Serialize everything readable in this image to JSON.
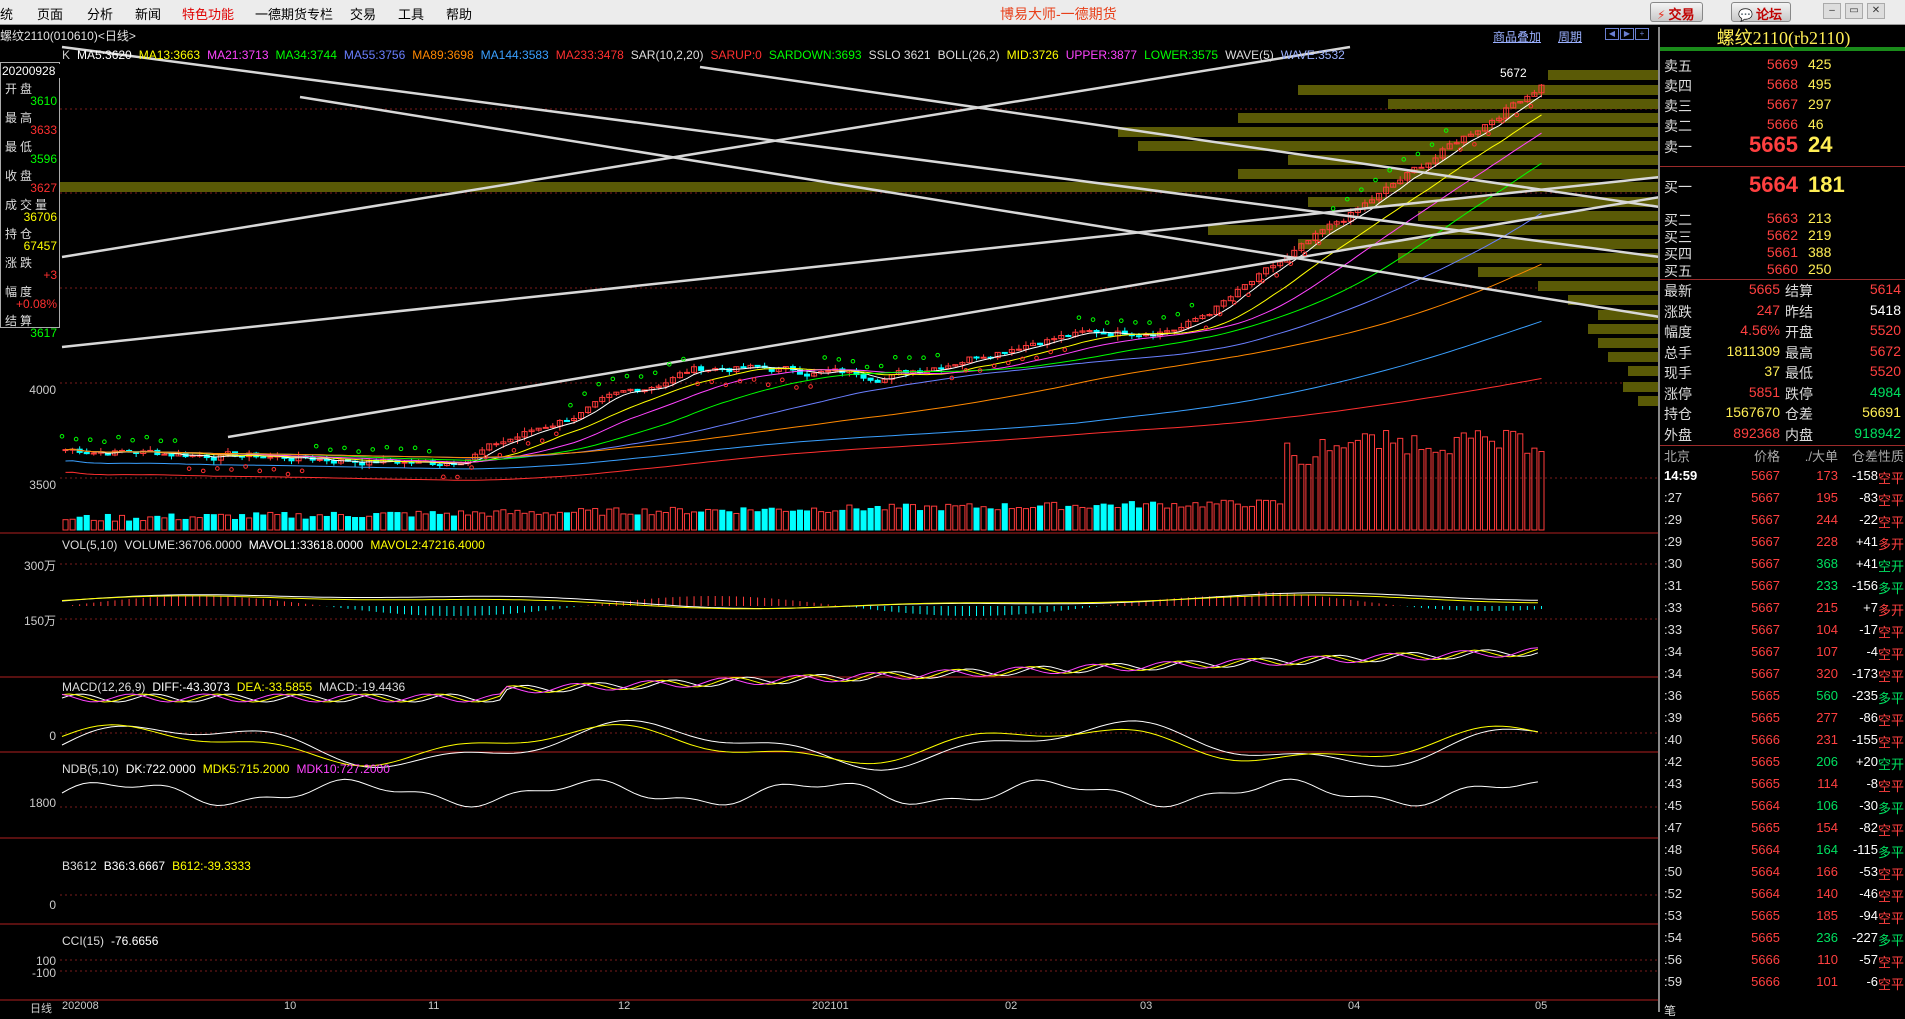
{
  "menu": [
    "统",
    "页面",
    "分析",
    "新闻",
    "特色功能",
    "一德期货专栏",
    "交易",
    "工具",
    "帮助"
  ],
  "app_title": "博易大师-一德期货",
  "top_buttons": {
    "trade": "交易",
    "forum": "论坛"
  },
  "colors": {
    "up": "#ff3b3b",
    "down": "#00ffff",
    "bg": "#000000",
    "grid": "#7a1c1c"
  },
  "chart_header": {
    "symbol": "螺纹2110(010610)<日线>",
    "overlay": "商品叠加",
    "period": "周期"
  },
  "main_indicators": [
    {
      "t": "K",
      "c": "#cccccc"
    },
    {
      "t": "MA5:3620",
      "c": "#ffffff"
    },
    {
      "t": "MA13:3663",
      "c": "#ffff00"
    },
    {
      "t": "MA21:3713",
      "c": "#ff44ff"
    },
    {
      "t": "MA34:3744",
      "c": "#00ff00"
    },
    {
      "t": "MA55:3756",
      "c": "#6a7fff"
    },
    {
      "t": "MA89:3698",
      "c": "#ff8800"
    },
    {
      "t": "MA144:3583",
      "c": "#3aa0ff"
    },
    {
      "t": "MA233:3478",
      "c": "#ff3030"
    },
    {
      "t": "SAR(10,2,20)",
      "c": "#dddddd"
    },
    {
      "t": "SARUP:0",
      "c": "#ff3030"
    },
    {
      "t": "SARDOWN:3693",
      "c": "#00ff00"
    },
    {
      "t": "SSLO 3621",
      "c": "#dddddd"
    },
    {
      "t": "BOLL(26,2)",
      "c": "#dddddd"
    },
    {
      "t": "MID:3726",
      "c": "#ffff00"
    },
    {
      "t": "UPPER:3877",
      "c": "#ff44ff"
    },
    {
      "t": "LOWER:3575",
      "c": "#00ff00"
    },
    {
      "t": "WAVE(5)",
      "c": "#dddddd"
    },
    {
      "t": "WAVE:3532",
      "c": "#9ab0ff"
    }
  ],
  "ohlc_box": {
    "date": "20200928",
    "rows": [
      {
        "label": "开盘",
        "value": "3610",
        "c": "#00ff00"
      },
      {
        "label": "最高",
        "value": "3633",
        "c": "#ff3030"
      },
      {
        "label": "最低",
        "value": "3596",
        "c": "#00ff00"
      },
      {
        "label": "收盘",
        "value": "3627",
        "c": "#ff3030"
      },
      {
        "label": "成交量",
        "value": "36706",
        "c": "#ffff00"
      },
      {
        "label": "持仓",
        "value": "67457",
        "c": "#ffff00"
      },
      {
        "label": "涨跌",
        "value": "+3",
        "c": "#ff3030"
      },
      {
        "label": "幅度",
        "value": "+0.08%",
        "c": "#ff3030"
      },
      {
        "label": "结算",
        "value": "3617",
        "c": "#00ff00"
      }
    ]
  },
  "max_label": "5672",
  "y_labels": {
    "main": [
      "4000",
      "3500"
    ],
    "vol": [
      "300万",
      "150万"
    ],
    "macd": [
      "0"
    ],
    "ndb": [
      "1800"
    ],
    "b3612": [
      "0"
    ],
    "cci": [
      "100",
      "-100"
    ]
  },
  "sub_indicators": {
    "vol": [
      {
        "t": "VOL(5,10)",
        "c": "#dddddd"
      },
      {
        "t": "VOLUME:36706.0000",
        "c": "#dddddd"
      },
      {
        "t": "MAVOL1:33618.0000",
        "c": "#ffffff"
      },
      {
        "t": "MAVOL2:47216.4000",
        "c": "#ffff00"
      }
    ],
    "macd": [
      {
        "t": "MACD(12,26,9)",
        "c": "#dddddd"
      },
      {
        "t": "DIFF:-43.3073",
        "c": "#ffffff"
      },
      {
        "t": "DEA:-33.5855",
        "c": "#ffff00"
      },
      {
        "t": "MACD:-19.4436",
        "c": "#dddddd"
      }
    ],
    "ndb": [
      {
        "t": "NDB(5,10)",
        "c": "#dddddd"
      },
      {
        "t": "DK:722.0000",
        "c": "#ffffff"
      },
      {
        "t": "MDK5:715.2000",
        "c": "#ffff00"
      },
      {
        "t": "MDK10:727.2000",
        "c": "#ff44ff"
      }
    ],
    "b3612": [
      {
        "t": "B3612",
        "c": "#dddddd"
      },
      {
        "t": "B36:3.6667",
        "c": "#ffffff"
      },
      {
        "t": "B612:-39.3333",
        "c": "#ffff00"
      }
    ],
    "cci": [
      {
        "t": "CCI(15)",
        "c": "#dddddd"
      },
      {
        "t": "-76.6656",
        "c": "#ffffff"
      }
    ]
  },
  "x_axis": [
    "日线",
    "202008",
    "10",
    "11",
    "12",
    "202101",
    "02",
    "03",
    "04",
    "05"
  ],
  "quote": {
    "title": "螺纹2110(rb2110)",
    "asks": [
      {
        "l": "卖五",
        "p": "5669",
        "v": "425"
      },
      {
        "l": "卖四",
        "p": "5668",
        "v": "495"
      },
      {
        "l": "卖三",
        "p": "5667",
        "v": "297"
      },
      {
        "l": "卖二",
        "p": "5666",
        "v": "46"
      },
      {
        "l": "卖一",
        "p": "5665",
        "v": "24"
      }
    ],
    "bids": [
      {
        "l": "买一",
        "p": "5664",
        "v": "181"
      },
      {
        "l": "买二",
        "p": "5663",
        "v": "213"
      },
      {
        "l": "买三",
        "p": "5662",
        "v": "219"
      },
      {
        "l": "买四",
        "p": "5661",
        "v": "388"
      },
      {
        "l": "买五",
        "p": "5660",
        "v": "250"
      }
    ],
    "stats": [
      {
        "a": "最新",
        "b": "5665",
        "bc": "red",
        "c": "结算",
        "d": "5614",
        "dc": "red"
      },
      {
        "a": "涨跌",
        "b": "247",
        "bc": "red",
        "c": "昨结",
        "d": "5418",
        "dc": "wht"
      },
      {
        "a": "幅度",
        "b": "4.56%",
        "bc": "red",
        "c": "开盘",
        "d": "5520",
        "dc": "red"
      },
      {
        "a": "总手",
        "b": "1811309",
        "bc": "yel",
        "c": "最高",
        "d": "5672",
        "dc": "red"
      },
      {
        "a": "现手",
        "b": "37",
        "bc": "yel",
        "c": "最低",
        "d": "5520",
        "dc": "red"
      },
      {
        "a": "涨停",
        "b": "5851",
        "bc": "red",
        "c": "跌停",
        "d": "4984",
        "dc": "grn"
      },
      {
        "a": "持仓",
        "b": "1567670",
        "bc": "yel",
        "c": "仓差",
        "d": "56691",
        "dc": "yel"
      },
      {
        "a": "外盘",
        "b": "892368",
        "bc": "red",
        "c": "内盘",
        "d": "918942",
        "dc": "grn"
      }
    ],
    "tick_header": [
      "北京",
      "价格",
      "./大单",
      "仓差",
      "性质"
    ],
    "ticks": [
      {
        "t": "14:59",
        "p": "5667",
        "v": "173",
        "d": "-158",
        "n": "空平",
        "dc": "red"
      },
      {
        "t": ":27",
        "p": "5667",
        "v": "195",
        "d": "-83",
        "n": "空平",
        "dc": "red"
      },
      {
        "t": ":29",
        "p": "5667",
        "v": "244",
        "d": "-22",
        "n": "空平",
        "dc": "red"
      },
      {
        "t": ":29",
        "p": "5667",
        "v": "228",
        "d": "+41",
        "n": "多开",
        "dc": "red"
      },
      {
        "t": ":30",
        "p": "5667",
        "v": "368",
        "d": "+41",
        "n": "空开",
        "dc": "grn"
      },
      {
        "t": ":31",
        "p": "5667",
        "v": "233",
        "d": "-156",
        "n": "多平",
        "dc": "grn"
      },
      {
        "t": ":33",
        "p": "5667",
        "v": "215",
        "d": "+7",
        "n": "多开",
        "dc": "red"
      },
      {
        "t": ":33",
        "p": "5667",
        "v": "104",
        "d": "-17",
        "n": "空平",
        "dc": "red"
      },
      {
        "t": ":34",
        "p": "5667",
        "v": "107",
        "d": "-4",
        "n": "空平",
        "dc": "red"
      },
      {
        "t": ":34",
        "p": "5667",
        "v": "320",
        "d": "-173",
        "n": "空平",
        "dc": "red"
      },
      {
        "t": ":36",
        "p": "5665",
        "v": "560",
        "d": "-235",
        "n": "多平",
        "dc": "grn"
      },
      {
        "t": ":39",
        "p": "5665",
        "v": "277",
        "d": "-86",
        "n": "空平",
        "dc": "red"
      },
      {
        "t": ":40",
        "p": "5666",
        "v": "231",
        "d": "-155",
        "n": "空平",
        "dc": "red"
      },
      {
        "t": ":42",
        "p": "5665",
        "v": "206",
        "d": "+20",
        "n": "空开",
        "dc": "grn"
      },
      {
        "t": ":43",
        "p": "5665",
        "v": "114",
        "d": "-8",
        "n": "空平",
        "dc": "red"
      },
      {
        "t": ":45",
        "p": "5664",
        "v": "106",
        "d": "-30",
        "n": "多平",
        "dc": "grn"
      },
      {
        "t": ":47",
        "p": "5665",
        "v": "154",
        "d": "-82",
        "n": "空平",
        "dc": "red"
      },
      {
        "t": ":48",
        "p": "5664",
        "v": "164",
        "d": "-115",
        "n": "多平",
        "dc": "grn"
      },
      {
        "t": ":50",
        "p": "5664",
        "v": "166",
        "d": "-53",
        "n": "空平",
        "dc": "red"
      },
      {
        "t": ":52",
        "p": "5664",
        "v": "140",
        "d": "-46",
        "n": "空平",
        "dc": "red"
      },
      {
        "t": ":53",
        "p": "5665",
        "v": "185",
        "d": "-94",
        "n": "空平",
        "dc": "red"
      },
      {
        "t": ":54",
        "p": "5665",
        "v": "236",
        "d": "-227",
        "n": "多平",
        "dc": "grn"
      },
      {
        "t": ":56",
        "p": "5666",
        "v": "110",
        "d": "-57",
        "n": "空平",
        "dc": "red"
      },
      {
        "t": ":59",
        "p": "5666",
        "v": "101",
        "d": "-6",
        "n": "空平",
        "dc": "red"
      }
    ],
    "tick_footer": "笔"
  }
}
